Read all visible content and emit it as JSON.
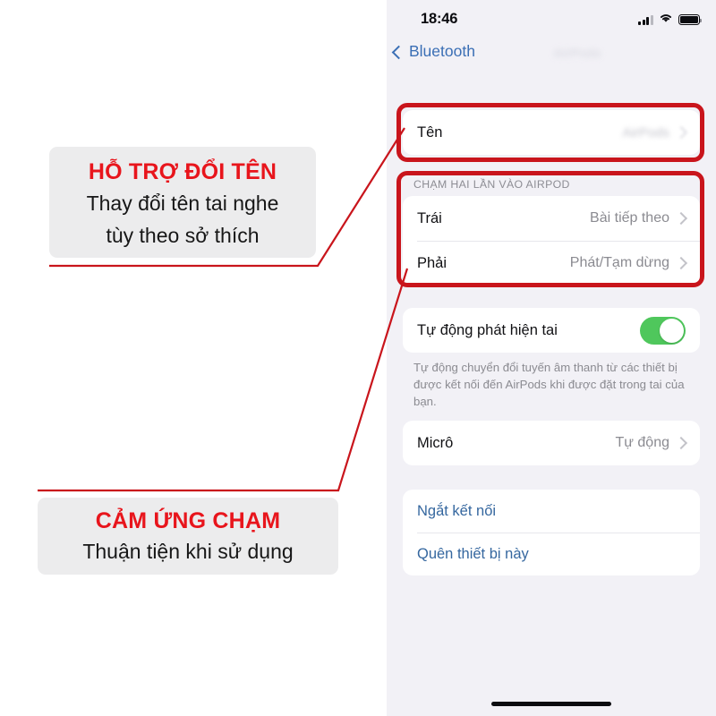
{
  "phone": {
    "status_bar": {
      "time": "18:46",
      "signal_icon": "cellular-signal-icon",
      "wifi_icon": "wifi-icon",
      "battery_icon": "battery-icon"
    },
    "nav": {
      "back_label": "Bluetooth",
      "back_icon": "chevron-left-icon",
      "title": "AirPods"
    },
    "name_row": {
      "label": "Tên",
      "value": "AirPods",
      "chevron_icon": "chevron-right-icon"
    },
    "double_tap": {
      "section_header": "CHẠM HAI LẦN VÀO AIRPOD",
      "rows": [
        {
          "label": "Trái",
          "value": "Bài tiếp theo",
          "chevron_icon": "chevron-right-icon"
        },
        {
          "label": "Phải",
          "value": "Phát/Tạm dừng",
          "chevron_icon": "chevron-right-icon"
        }
      ]
    },
    "auto_detect": {
      "label": "Tự động phát hiện tai",
      "toggle_state": "on",
      "toggle_color": "#4fc75c",
      "note": "Tự động chuyển đổi tuyến âm thanh từ các thiết bị được kết nối đến AirPods khi được đặt trong tai của bạn."
    },
    "micro_row": {
      "label": "Micrô",
      "value": "Tự động",
      "chevron_icon": "chevron-right-icon"
    },
    "actions": [
      {
        "label": "Ngắt kết nối"
      },
      {
        "label": "Quên thiết bị này"
      }
    ],
    "home_indicator": "home-indicator"
  },
  "annotations": {
    "accent_color": "#c9151c",
    "title_color": "#e8151c",
    "callouts": [
      {
        "title": "HỖ TRỢ ĐỔI TÊN",
        "body_line1": "Thay đổi tên tai nghe",
        "body_line2": "tùy theo sở thích"
      },
      {
        "title": "CẢM ỨNG CHẠM",
        "body_line1": "Thuận tiện khi sử dụng"
      }
    ]
  }
}
